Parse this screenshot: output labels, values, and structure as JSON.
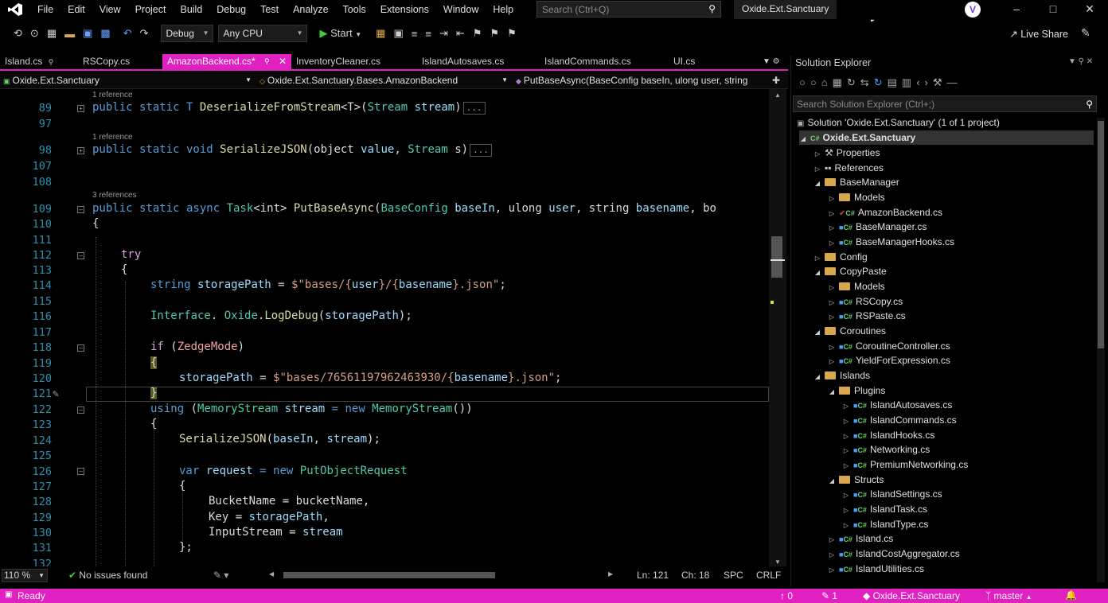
{
  "menu": [
    "File",
    "Edit",
    "View",
    "Project",
    "Build",
    "Debug",
    "Test",
    "Analyze",
    "Tools",
    "Extensions",
    "Window",
    "Help"
  ],
  "search": {
    "placeholder": "Search (Ctrl+Q)"
  },
  "solution_title": "Oxide.Ext.Sanctuary",
  "toolbar": {
    "config": "Debug",
    "platform": "Any CPU",
    "start": "Start",
    "live_share": "Live Share"
  },
  "tabs": [
    "Island.cs",
    "RSCopy.cs",
    "AmazonBackend.cs*",
    "InventoryCleaner.cs",
    "IslandAutosaves.cs",
    "IslandCommands.cs",
    "UI.cs"
  ],
  "navbar": {
    "project": "Oxide.Ext.Sanctuary",
    "class": "Oxide.Ext.Sanctuary.Bases.AmazonBackend",
    "member": "PutBaseAsync(BaseConfig baseIn, ulong user, string"
  },
  "codelens": {
    "r89": "1 reference",
    "r98": "1 reference",
    "r109": "3 references"
  },
  "line_numbers": [
    "89",
    "97",
    "98",
    "107",
    "108",
    "109",
    "110",
    "111",
    "112",
    "113",
    "114",
    "115",
    "116",
    "117",
    "118",
    "119",
    "120",
    "121",
    "122",
    "123",
    "124",
    "125",
    "126",
    "127",
    "128",
    "129",
    "130",
    "131",
    "132"
  ],
  "code": {
    "l89": [
      "public static T ",
      "DeserializeFromStream",
      "<T>(",
      "Stream",
      " ",
      "stream",
      ")",
      "..."
    ],
    "l98": [
      "public static void ",
      "SerializeJSON",
      "(object ",
      "value",
      ", ",
      "Stream",
      " s)",
      "..."
    ],
    "l109": [
      "public static async ",
      "Task",
      "<int> ",
      "PutBaseAsync",
      "(",
      "BaseConfig",
      " ",
      "baseIn",
      ", ulong ",
      "user",
      ", string ",
      "basename",
      ", bo"
    ],
    "l110": "{",
    "l112": "try",
    "l113": "{",
    "l114": [
      "string ",
      "storagePath",
      " = ",
      "$\"bases/{",
      "user",
      "}/{",
      "basename",
      "}.json\"",
      ";"
    ],
    "l116": [
      "Interface",
      ".",
      " Oxide",
      ".",
      "LogDebug",
      "(",
      "storagePath",
      ");"
    ],
    "l118": [
      "if",
      " (",
      "ZedgeMode",
      ")"
    ],
    "l119": "{",
    "l120": [
      "storagePath",
      " = ",
      "$\"bases/76561197962463930/{",
      "basename",
      "}.json\"",
      ";"
    ],
    "l121": "}",
    "l122": [
      "using",
      " (",
      "MemoryStream",
      " ",
      "stream",
      " = new ",
      "MemoryStream",
      "())"
    ],
    "l123": "{",
    "l124": [
      "SerializeJSON",
      "(",
      "baseIn",
      ", ",
      "stream",
      ");"
    ],
    "l126": [
      "var",
      " ",
      "request",
      " = new ",
      "PutObjectRequest"
    ],
    "l127": "{",
    "l128": [
      "BucketName",
      " = ",
      "bucketName",
      ","
    ],
    "l129": [
      "Key",
      " = ",
      "storagePath",
      ","
    ],
    "l130": [
      "InputStream",
      " = ",
      "stream"
    ],
    "l131": "};"
  },
  "editor_status": {
    "zoom": "110 %",
    "issues": "No issues found",
    "ln": "Ln: 121",
    "ch": "Ch: 18",
    "spc": "SPC",
    "crlf": "CRLF"
  },
  "status": {
    "ready": "Ready",
    "up": "0",
    "pencil": "1",
    "repo": "Oxide.Ext.Sanctuary",
    "branch": "master"
  },
  "solution_explorer": {
    "title": "Solution Explorer",
    "search_placeholder": "Search Solution Explorer (Ctrl+;)",
    "items": [
      {
        "label": "Solution 'Oxide.Ext.Sanctuary' (1 of 1 project)",
        "kind": "solution"
      },
      {
        "label": "Oxide.Ext.Sanctuary",
        "kind": "project"
      },
      {
        "label": "Properties",
        "kind": "props"
      },
      {
        "label": "References",
        "kind": "refs"
      },
      {
        "label": "BaseManager",
        "kind": "folder"
      },
      {
        "label": "Models",
        "kind": "folder"
      },
      {
        "label": "AmazonBackend.cs",
        "kind": "cs"
      },
      {
        "label": "BaseManager.cs",
        "kind": "cs"
      },
      {
        "label": "BaseManagerHooks.cs",
        "kind": "cs"
      },
      {
        "label": "Config",
        "kind": "folder"
      },
      {
        "label": "CopyPaste",
        "kind": "folder"
      },
      {
        "label": "Models",
        "kind": "folder"
      },
      {
        "label": "RSCopy.cs",
        "kind": "cs"
      },
      {
        "label": "RSPaste.cs",
        "kind": "cs"
      },
      {
        "label": "Coroutines",
        "kind": "folder"
      },
      {
        "label": "CoroutineController.cs",
        "kind": "cs"
      },
      {
        "label": "YieldForExpression.cs",
        "kind": "cs"
      },
      {
        "label": "Islands",
        "kind": "folder"
      },
      {
        "label": "Plugins",
        "kind": "folder"
      },
      {
        "label": "IslandAutosaves.cs",
        "kind": "cs"
      },
      {
        "label": "IslandCommands.cs",
        "kind": "cs"
      },
      {
        "label": "IslandHooks.cs",
        "kind": "cs"
      },
      {
        "label": "Networking.cs",
        "kind": "cs"
      },
      {
        "label": "PremiumNetworking.cs",
        "kind": "cs"
      },
      {
        "label": "Structs",
        "kind": "folder"
      },
      {
        "label": "IslandSettings.cs",
        "kind": "cs"
      },
      {
        "label": "IslandTask.cs",
        "kind": "cs"
      },
      {
        "label": "IslandType.cs",
        "kind": "cs"
      },
      {
        "label": "Island.cs",
        "kind": "cs"
      },
      {
        "label": "IslandCostAggregator.cs",
        "kind": "cs"
      },
      {
        "label": "IslandUtilities.cs",
        "kind": "cs"
      }
    ]
  },
  "colors": {
    "accent": "#e020c0",
    "keyword": "#569cd6",
    "type": "#4ec9b0",
    "method": "#dcdcaa",
    "string": "#d69d85",
    "param": "#9cdcfe",
    "line_number": "#2b91af"
  }
}
